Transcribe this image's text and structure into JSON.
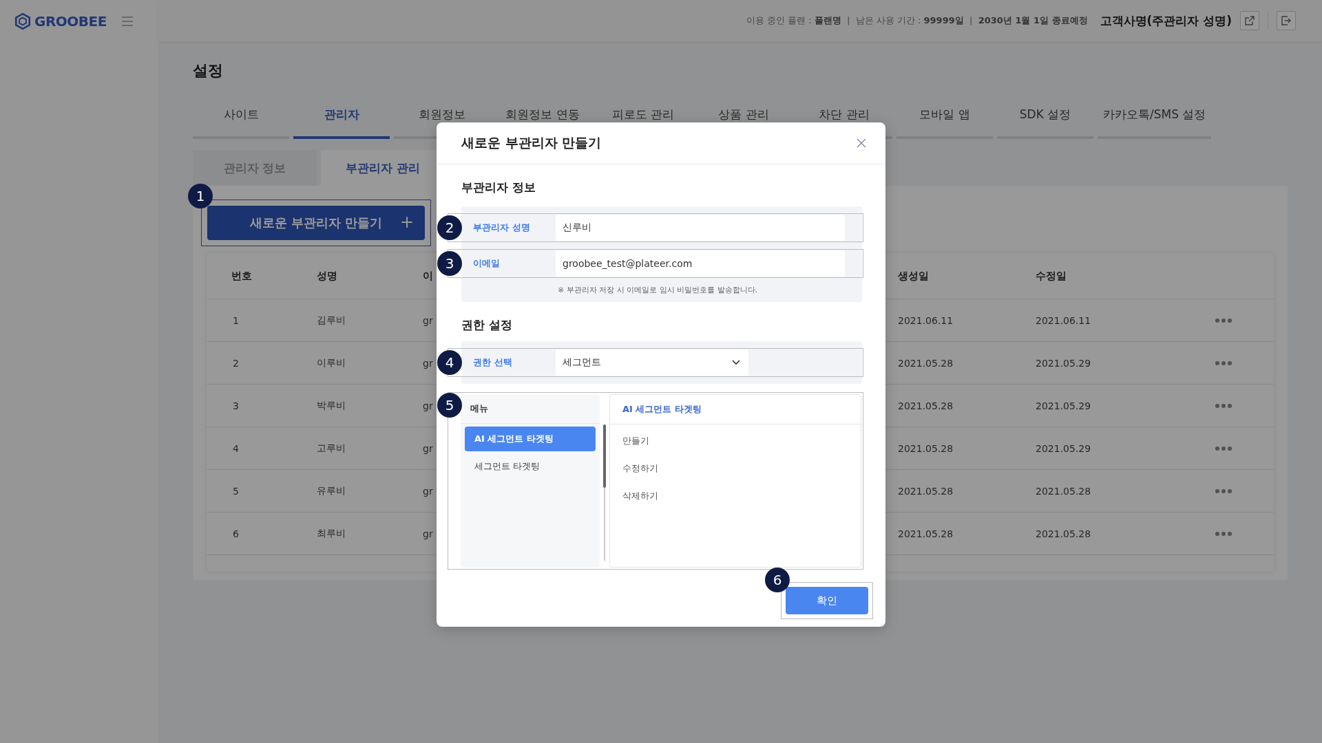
{
  "header": {
    "logo": "GROOBEE",
    "plan_info": "이용 중인 플랜 : **플랜명**  |  남은 사용 기간 : **99999일**  |  **2030년 1월 1일 종료예정**",
    "account": "고객사명(주관리자 성명)"
  },
  "page_title": "설정",
  "tabs": [
    {
      "label": "사이트",
      "selected": false
    },
    {
      "label": "관리자",
      "selected": true
    },
    {
      "label": "회원정보",
      "selected": false
    },
    {
      "label": "회원정보 연동",
      "selected": false
    },
    {
      "label": "피로도 관리",
      "selected": false
    },
    {
      "label": "상품 관리",
      "selected": false
    },
    {
      "label": "차단 관리",
      "selected": false
    },
    {
      "label": "모바일 앱",
      "selected": false
    },
    {
      "label": "SDK 설정",
      "selected": false
    },
    {
      "label": "카카오톡/SMS 설정",
      "selected": false
    }
  ],
  "sub_tabs": [
    {
      "label": "관리자 정보",
      "selected": false
    },
    {
      "label": "부관리자 관리",
      "selected": true
    }
  ],
  "create_button": {
    "label": "새로운 부관리자 만들기",
    "icon": "+",
    "marker": "1"
  },
  "table": {
    "columns": [
      "번호",
      "성명",
      "이",
      "생성일",
      "수정일"
    ],
    "rows": [
      {
        "cells": [
          "1",
          "김루비",
          "gr",
          "2021.06.11",
          "2021.06.11"
        ]
      },
      {
        "cells": [
          "2",
          "이루비",
          "gr",
          "2021.05.28",
          "2021.05.29"
        ]
      },
      {
        "cells": [
          "3",
          "박루비",
          "gr",
          "2021.05.28",
          "2021.05.29"
        ]
      },
      {
        "cells": [
          "4",
          "고루비",
          "gr",
          "2021.05.28",
          "2021.05.29"
        ]
      },
      {
        "cells": [
          "5",
          "유루비",
          "gr",
          "2021.05.28",
          "2021.05.28"
        ]
      },
      {
        "cells": [
          "6",
          "최루비",
          "gr",
          "2021.05.28",
          "2021.05.28"
        ]
      }
    ]
  },
  "modal": {
    "title": "새로운 부관리자 만들기",
    "info_title": "부관리자 정보",
    "fields": [
      {
        "label": "부관리자 성명",
        "value": "신루비",
        "marker": "2"
      },
      {
        "label": "이메일",
        "value": "groobee_test@plateer.com",
        "marker": "3"
      }
    ],
    "note": "※ 부관리자 저장 시 이메일로 임시 비밀번호를 발송합니다.",
    "permission_title": "권한 설정",
    "permission_select": {
      "label": "권한 선택",
      "value": "세그먼트",
      "marker": "4"
    },
    "menu": {
      "heading": "메뉴",
      "marker": "5",
      "items": [
        {
          "label": "AI 세그먼트 타겟팅",
          "selected": true
        },
        {
          "label": "세그먼트 타겟팅",
          "selected": false
        }
      ],
      "detail_heading": "AI 세그먼트 타겟팅",
      "actions": [
        "만들기",
        "수정하기",
        "삭제하기"
      ]
    },
    "confirm_button": {
      "label": "확인",
      "marker": "6"
    }
  }
}
